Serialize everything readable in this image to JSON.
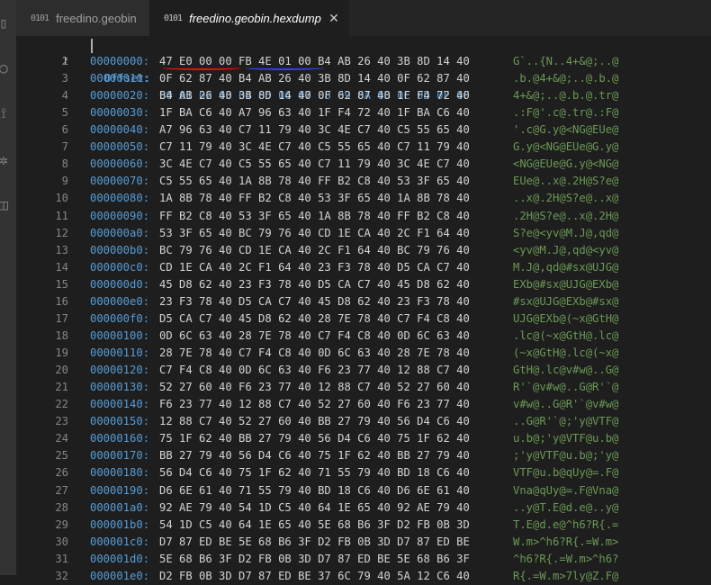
{
  "tabs": [
    {
      "label": "freedino.geobin",
      "icon": "binary-file-icon",
      "active": false
    },
    {
      "label": "freedino.geobin.hexdump",
      "icon": "binary-file-icon",
      "active": true
    }
  ],
  "close_glyph": "✕",
  "file_icon_glyph": "0101",
  "header": {
    "line": "1",
    "label": "Offset:",
    "columns": "00 01 02 03 04 05 06 07 08 09 0A 0B 0C 0D 0E 0F"
  },
  "rows": [
    {
      "ln": "2",
      "off": "00000000:",
      "hex": "47 E0 00 00 FB 4E 01 00 B4 AB 26 40 3B 8D 14 40",
      "asc": "G`..{N..4+&@;..@"
    },
    {
      "ln": "3",
      "off": "00000010:",
      "hex": "0F 62 87 40 B4 AB 26 40 3B 8D 14 40 0F 62 87 40",
      "asc": ".b.@4+&@;..@.b.@"
    },
    {
      "ln": "4",
      "off": "00000020:",
      "hex": "B4 AB 26 40 3B 8D 14 40 0F 62 87 40 1F F4 72 40",
      "asc": "4+&@;..@.b.@.tr@"
    },
    {
      "ln": "5",
      "off": "00000030:",
      "hex": "1F BA C6 40 A7 96 63 40 1F F4 72 40 1F BA C6 40",
      "asc": ".:F@'.c@.tr@.:F@"
    },
    {
      "ln": "6",
      "off": "00000040:",
      "hex": "A7 96 63 40 C7 11 79 40 3C 4E C7 40 C5 55 65 40",
      "asc": "'.c@G.y@<NG@EUe@"
    },
    {
      "ln": "7",
      "off": "00000050:",
      "hex": "C7 11 79 40 3C 4E C7 40 C5 55 65 40 C7 11 79 40",
      "asc": "G.y@<NG@EUe@G.y@"
    },
    {
      "ln": "8",
      "off": "00000060:",
      "hex": "3C 4E C7 40 C5 55 65 40 C7 11 79 40 3C 4E C7 40",
      "asc": "<NG@EUe@G.y@<NG@"
    },
    {
      "ln": "9",
      "off": "00000070:",
      "hex": "C5 55 65 40 1A 8B 78 40 FF B2 C8 40 53 3F 65 40",
      "asc": "EUe@..x@.2H@S?e@"
    },
    {
      "ln": "10",
      "off": "00000080:",
      "hex": "1A 8B 78 40 FF B2 C8 40 53 3F 65 40 1A 8B 78 40",
      "asc": "..x@.2H@S?e@..x@"
    },
    {
      "ln": "11",
      "off": "00000090:",
      "hex": "FF B2 C8 40 53 3F 65 40 1A 8B 78 40 FF B2 C8 40",
      "asc": ".2H@S?e@..x@.2H@"
    },
    {
      "ln": "12",
      "off": "000000a0:",
      "hex": "53 3F 65 40 BC 79 76 40 CD 1E CA 40 2C F1 64 40",
      "asc": "S?e@<yv@M.J@,qd@"
    },
    {
      "ln": "13",
      "off": "000000b0:",
      "hex": "BC 79 76 40 CD 1E CA 40 2C F1 64 40 BC 79 76 40",
      "asc": "<yv@M.J@,qd@<yv@"
    },
    {
      "ln": "14",
      "off": "000000c0:",
      "hex": "CD 1E CA 40 2C F1 64 40 23 F3 78 40 D5 CA C7 40",
      "asc": "M.J@,qd@#sx@UJG@"
    },
    {
      "ln": "15",
      "off": "000000d0:",
      "hex": "45 D8 62 40 23 F3 78 40 D5 CA C7 40 45 D8 62 40",
      "asc": "EXb@#sx@UJG@EXb@"
    },
    {
      "ln": "16",
      "off": "000000e0:",
      "hex": "23 F3 78 40 D5 CA C7 40 45 D8 62 40 23 F3 78 40",
      "asc": "#sx@UJG@EXb@#sx@"
    },
    {
      "ln": "17",
      "off": "000000f0:",
      "hex": "D5 CA C7 40 45 D8 62 40 28 7E 78 40 C7 F4 C8 40",
      "asc": "UJG@EXb@(~x@GtH@"
    },
    {
      "ln": "18",
      "off": "00000100:",
      "hex": "0D 6C 63 40 28 7E 78 40 C7 F4 C8 40 0D 6C 63 40",
      "asc": ".lc@(~x@GtH@.lc@"
    },
    {
      "ln": "19",
      "off": "00000110:",
      "hex": "28 7E 78 40 C7 F4 C8 40 0D 6C 63 40 28 7E 78 40",
      "asc": "(~x@GtH@.lc@(~x@"
    },
    {
      "ln": "20",
      "off": "00000120:",
      "hex": "C7 F4 C8 40 0D 6C 63 40 F6 23 77 40 12 88 C7 40",
      "asc": "GtH@.lc@v#w@..G@"
    },
    {
      "ln": "21",
      "off": "00000130:",
      "hex": "52 27 60 40 F6 23 77 40 12 88 C7 40 52 27 60 40",
      "asc": "R'`@v#w@..G@R'`@"
    },
    {
      "ln": "22",
      "off": "00000140:",
      "hex": "F6 23 77 40 12 88 C7 40 52 27 60 40 F6 23 77 40",
      "asc": "v#w@..G@R'`@v#w@"
    },
    {
      "ln": "23",
      "off": "00000150:",
      "hex": "12 88 C7 40 52 27 60 40 BB 27 79 40 56 D4 C6 40",
      "asc": "..G@R'`@;'y@VTF@"
    },
    {
      "ln": "24",
      "off": "00000160:",
      "hex": "75 1F 62 40 BB 27 79 40 56 D4 C6 40 75 1F 62 40",
      "asc": "u.b@;'y@VTF@u.b@"
    },
    {
      "ln": "25",
      "off": "00000170:",
      "hex": "BB 27 79 40 56 D4 C6 40 75 1F 62 40 BB 27 79 40",
      "asc": ";'y@VTF@u.b@;'y@"
    },
    {
      "ln": "26",
      "off": "00000180:",
      "hex": "56 D4 C6 40 75 1F 62 40 71 55 79 40 BD 18 C6 40",
      "asc": "VTF@u.b@qUy@=.F@"
    },
    {
      "ln": "27",
      "off": "00000190:",
      "hex": "D6 6E 61 40 71 55 79 40 BD 18 C6 40 D6 6E 61 40",
      "asc": "Vna@qUy@=.F@Vna@"
    },
    {
      "ln": "28",
      "off": "000001a0:",
      "hex": "92 AE 79 40 54 1D C5 40 64 1E 65 40 92 AE 79 40",
      "asc": "..y@T.E@d.e@..y@"
    },
    {
      "ln": "29",
      "off": "000001b0:",
      "hex": "54 1D C5 40 64 1E 65 40 5E 68 B6 3F D2 FB 0B 3D",
      "asc": "T.E@d.e@^h6?R{.="
    },
    {
      "ln": "30",
      "off": "000001c0:",
      "hex": "D7 87 ED BE 5E 68 B6 3F D2 FB 0B 3D D7 87 ED BE",
      "asc": "W.m>^h6?R{.=W.m>"
    },
    {
      "ln": "31",
      "off": "000001d0:",
      "hex": "5E 68 B6 3F D2 FB 0B 3D D7 87 ED BE 5E 68 B6 3F",
      "asc": "^h6?R{.=W.m>^h6?"
    },
    {
      "ln": "32",
      "off": "000001e0:",
      "hex": "D2 FB 0B 3D D7 87 ED BE 37 6C 79 40 5A 12 C6 40",
      "asc": "R{.=W.m>7ly@Z.F@"
    }
  ]
}
